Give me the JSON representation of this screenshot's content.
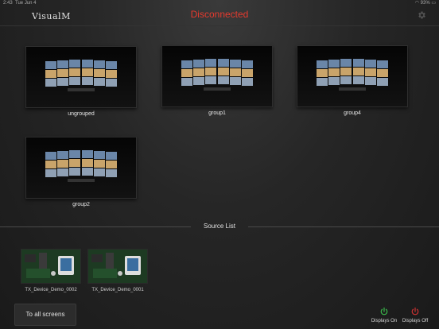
{
  "status_bar": {
    "time": "2:43",
    "date": "Tue Jun 4",
    "battery": "93%"
  },
  "header": {
    "logo": "VisualM",
    "connection_status": "Disconnected"
  },
  "groups": [
    {
      "label": "ungrouped"
    },
    {
      "label": "group1"
    },
    {
      "label": "group4"
    },
    {
      "label": "group2"
    }
  ],
  "source_list": {
    "title": "Source List",
    "items": [
      {
        "label": "TX_Device_Demo_0002"
      },
      {
        "label": "TX_Device_Demo_0001"
      }
    ]
  },
  "footer": {
    "to_all_label": "To all screens",
    "displays_on_label": "Displays On",
    "displays_off_label": "Displays Off"
  },
  "colors": {
    "disconnected": "#e63a2e",
    "power_on": "#3ab44a",
    "power_off": "#c83232"
  },
  "icons": [
    "settings-gear-icon",
    "power-on-icon",
    "power-off-icon"
  ]
}
